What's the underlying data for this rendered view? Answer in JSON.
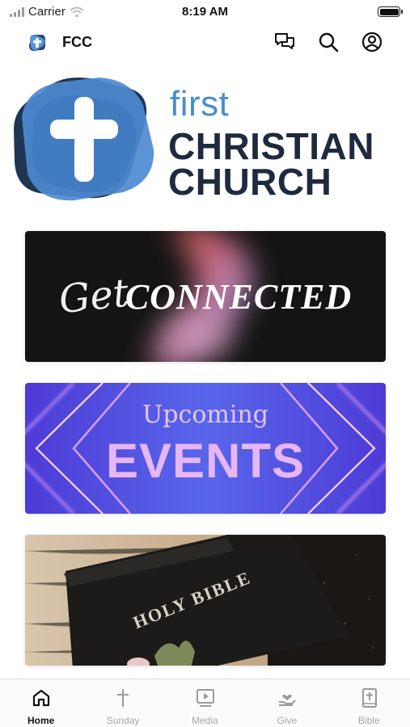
{
  "status_bar": {
    "carrier": "Carrier",
    "time": "8:19 AM"
  },
  "header": {
    "app_name": "FCC",
    "icons": [
      "chat-icon",
      "search-icon",
      "profile-icon"
    ]
  },
  "brand": {
    "line1": "first",
    "line2": "CHRISTIAN",
    "line3": "CHURCH"
  },
  "cards": [
    {
      "name": "get-connected",
      "script_text": "Get",
      "main_text": "CONNECTED"
    },
    {
      "name": "upcoming-events",
      "top_text": "Upcoming",
      "main_text": "EVENTS"
    },
    {
      "name": "holy-bible",
      "main_text": "HOLY BIBLE"
    }
  ],
  "tabbar": {
    "active": "Home",
    "tabs": [
      {
        "label": "Home",
        "icon": "home-icon"
      },
      {
        "label": "Sunday",
        "icon": "cross-icon"
      },
      {
        "label": "Media",
        "icon": "media-icon"
      },
      {
        "label": "Give",
        "icon": "give-icon"
      },
      {
        "label": "Bible",
        "icon": "bible-icon"
      }
    ]
  },
  "colors": {
    "brand_blue": "#4a8ccf",
    "brand_navy": "#1e2b3e",
    "events_purple": "#5866ea"
  }
}
